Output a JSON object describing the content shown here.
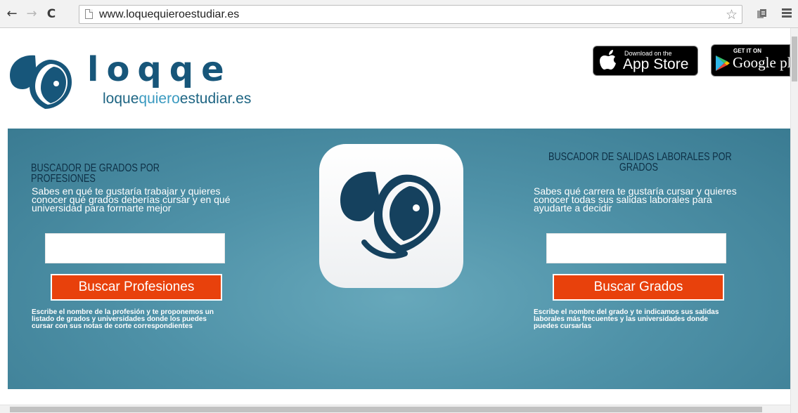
{
  "browser": {
    "url": "www.loquequieroestudiar.es",
    "back_glyph": "←",
    "forward_glyph": "→",
    "reload_glyph": "C",
    "star_glyph": "☆"
  },
  "header": {
    "brand_name": "loqqe",
    "domain_parts": [
      "loque",
      "quiero",
      "estudiar.es"
    ],
    "appstore": {
      "small": "Download on the",
      "big": "App Store"
    },
    "googleplay": {
      "small": "GET IT ON",
      "big": "Google pla"
    }
  },
  "left": {
    "title": "BUSCADOR DE GRADOS POR PROFESIONES",
    "desc_lines": [
      "Sabes en qué te gustaría trabajar y quieres",
      "conocer qué grados deberías cursar y en qué",
      "universidad para formarte mejor"
    ],
    "input_value": "",
    "button": "Buscar Profesiones",
    "hint_lines": [
      "Escribe el nombre de la profesión y te proponemos un",
      "listado de grados y universidades donde los puedes",
      "cursar con sus notas de corte correspondientes"
    ]
  },
  "right": {
    "title_lines": [
      "BUSCADOR DE SALIDAS LABORALES POR",
      "GRADOS"
    ],
    "desc_lines": [
      "Sabes qué carrera te gustaría cursar y quieres",
      "conocer todas sus salidas laborales para",
      "ayudarte a decidir"
    ],
    "input_value": "",
    "button": "Buscar Grados",
    "hint_lines": [
      "Escribe el nombre del grado y te indicamos sus salidas",
      "laborales más frecuentes y las universidades donde",
      "puedes cursarlas"
    ]
  },
  "colors": {
    "brand_dark": "#17567a",
    "brand_light": "#3a9ac0",
    "hero_teal": "#4f92a8",
    "button_orange": "#e8410c",
    "title_navy": "#0d2f45"
  },
  "icons": [
    "back-icon",
    "forward-icon",
    "reload-icon",
    "page-icon",
    "star-icon",
    "extension-icon",
    "menu-icon",
    "loqqe-logo-icon",
    "apple-icon",
    "google-play-icon"
  ]
}
